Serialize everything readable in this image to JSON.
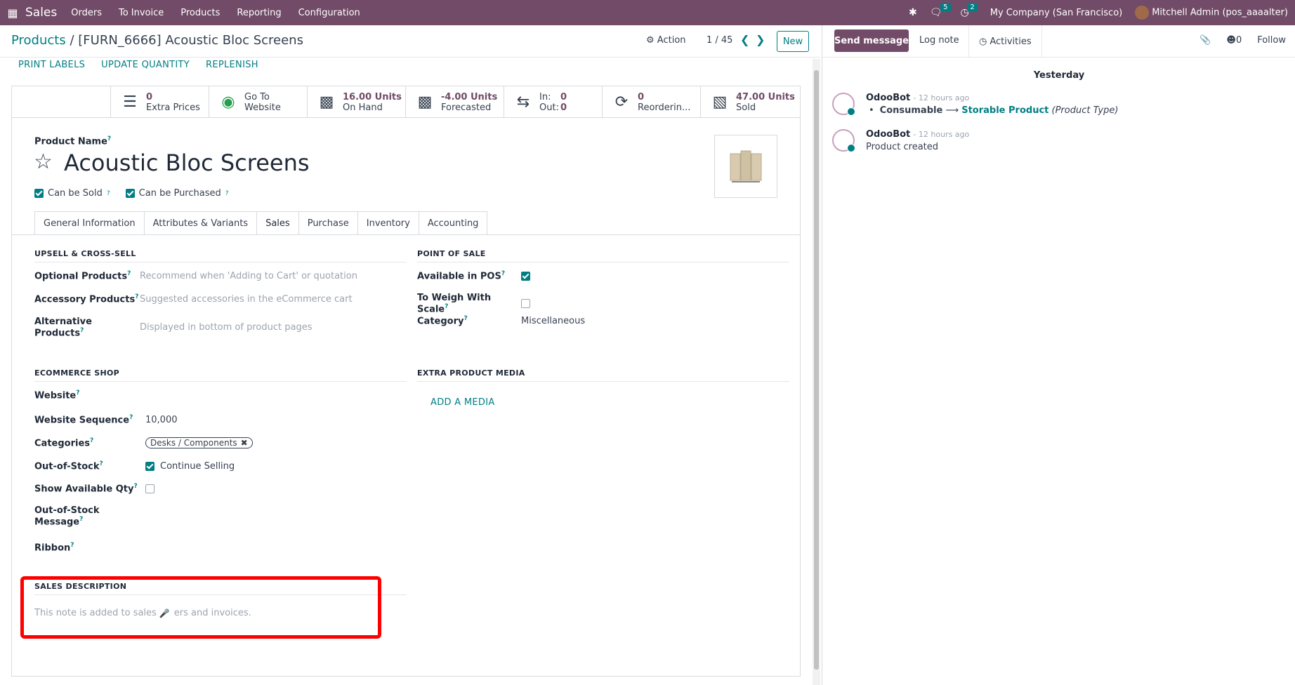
{
  "navbar": {
    "app_name": "Sales",
    "menu": [
      "Orders",
      "To Invoice",
      "Products",
      "Reporting",
      "Configuration"
    ],
    "messages_count": "5",
    "activities_count": "2",
    "company": "My Company (San Francisco)",
    "user": "Mitchell Admin (pos_aaaalter)"
  },
  "control_panel": {
    "breadcrumb_parent": "Products",
    "breadcrumb_sep": "/",
    "breadcrumb_current": "[FURN_6666] Acoustic Bloc Screens",
    "action_label": "Action",
    "pager": "1 / 45",
    "new_label": "New"
  },
  "header_buttons": [
    "PRINT LABELS",
    "UPDATE QUANTITY",
    "REPLENISH"
  ],
  "stats": {
    "extra_prices": {
      "num": "0",
      "label": "Extra Prices"
    },
    "website": {
      "line1": "Go To",
      "line2": "Website"
    },
    "on_hand": {
      "num": "16.00 Units",
      "label": "On Hand"
    },
    "forecasted": {
      "num": "-4.00 Units",
      "label": "Forecasted"
    },
    "inout": {
      "in_label": "In:",
      "in_val": "0",
      "out_label": "Out:",
      "out_val": "0"
    },
    "reordering": {
      "num": "0",
      "label": "Reorderin..."
    },
    "sold": {
      "num": "47.00 Units",
      "label": "Sold"
    }
  },
  "product": {
    "name_label": "Product Name",
    "name": "Acoustic Bloc Screens",
    "can_be_sold": "Can be Sold",
    "can_be_purchased": "Can be Purchased"
  },
  "tabs": [
    "General Information",
    "Attributes & Variants",
    "Sales",
    "Purchase",
    "Inventory",
    "Accounting"
  ],
  "upsell": {
    "title": "UPSELL & CROSS-SELL",
    "optional_label": "Optional Products",
    "optional_ph": "Recommend when 'Adding to Cart' or quotation",
    "accessory_label": "Accessory Products",
    "accessory_ph": "Suggested accessories in the eCommerce cart",
    "alternative_label": "Alternative Products",
    "alternative_ph": "Displayed in bottom of product pages"
  },
  "pos": {
    "title": "POINT OF SALE",
    "available_label": "Available in POS",
    "weigh_label": "To Weigh With Scale",
    "category_label": "Category",
    "category_val": "Miscellaneous"
  },
  "ecommerce": {
    "title": "ECOMMERCE SHOP",
    "website_label": "Website",
    "sequence_label": "Website Sequence",
    "sequence_val": "10,000",
    "categories_label": "Categories",
    "category_tag": "Desks / Components",
    "oos_label": "Out-of-Stock",
    "oos_val": "Continue Selling",
    "show_qty_label": "Show Available Qty",
    "oos_msg_label": "Out-of-Stock Message",
    "ribbon_label": "Ribbon"
  },
  "media": {
    "title": "EXTRA PRODUCT MEDIA",
    "add_label": "ADD A MEDIA"
  },
  "sales_desc": {
    "title": "SALES DESCRIPTION",
    "ph_a": "This note is added to sales",
    "ph_b": "ers and invoices."
  },
  "chatter": {
    "send_label": "Send message",
    "log_label": "Log note",
    "activities_label": "Activities",
    "followers_count": "0",
    "follow_label": "Follow",
    "date_sep": "Yesterday",
    "messages": [
      {
        "author": "OdooBot",
        "time": "- 12 hours ago",
        "old": "Consumable",
        "new": "Storable Product",
        "field": "(Product Type)"
      },
      {
        "author": "OdooBot",
        "time": "- 12 hours ago",
        "text": "Product created"
      }
    ]
  },
  "colors": {
    "brand": "#714B67",
    "accent": "#017e84",
    "highlight": "#ff0000"
  }
}
